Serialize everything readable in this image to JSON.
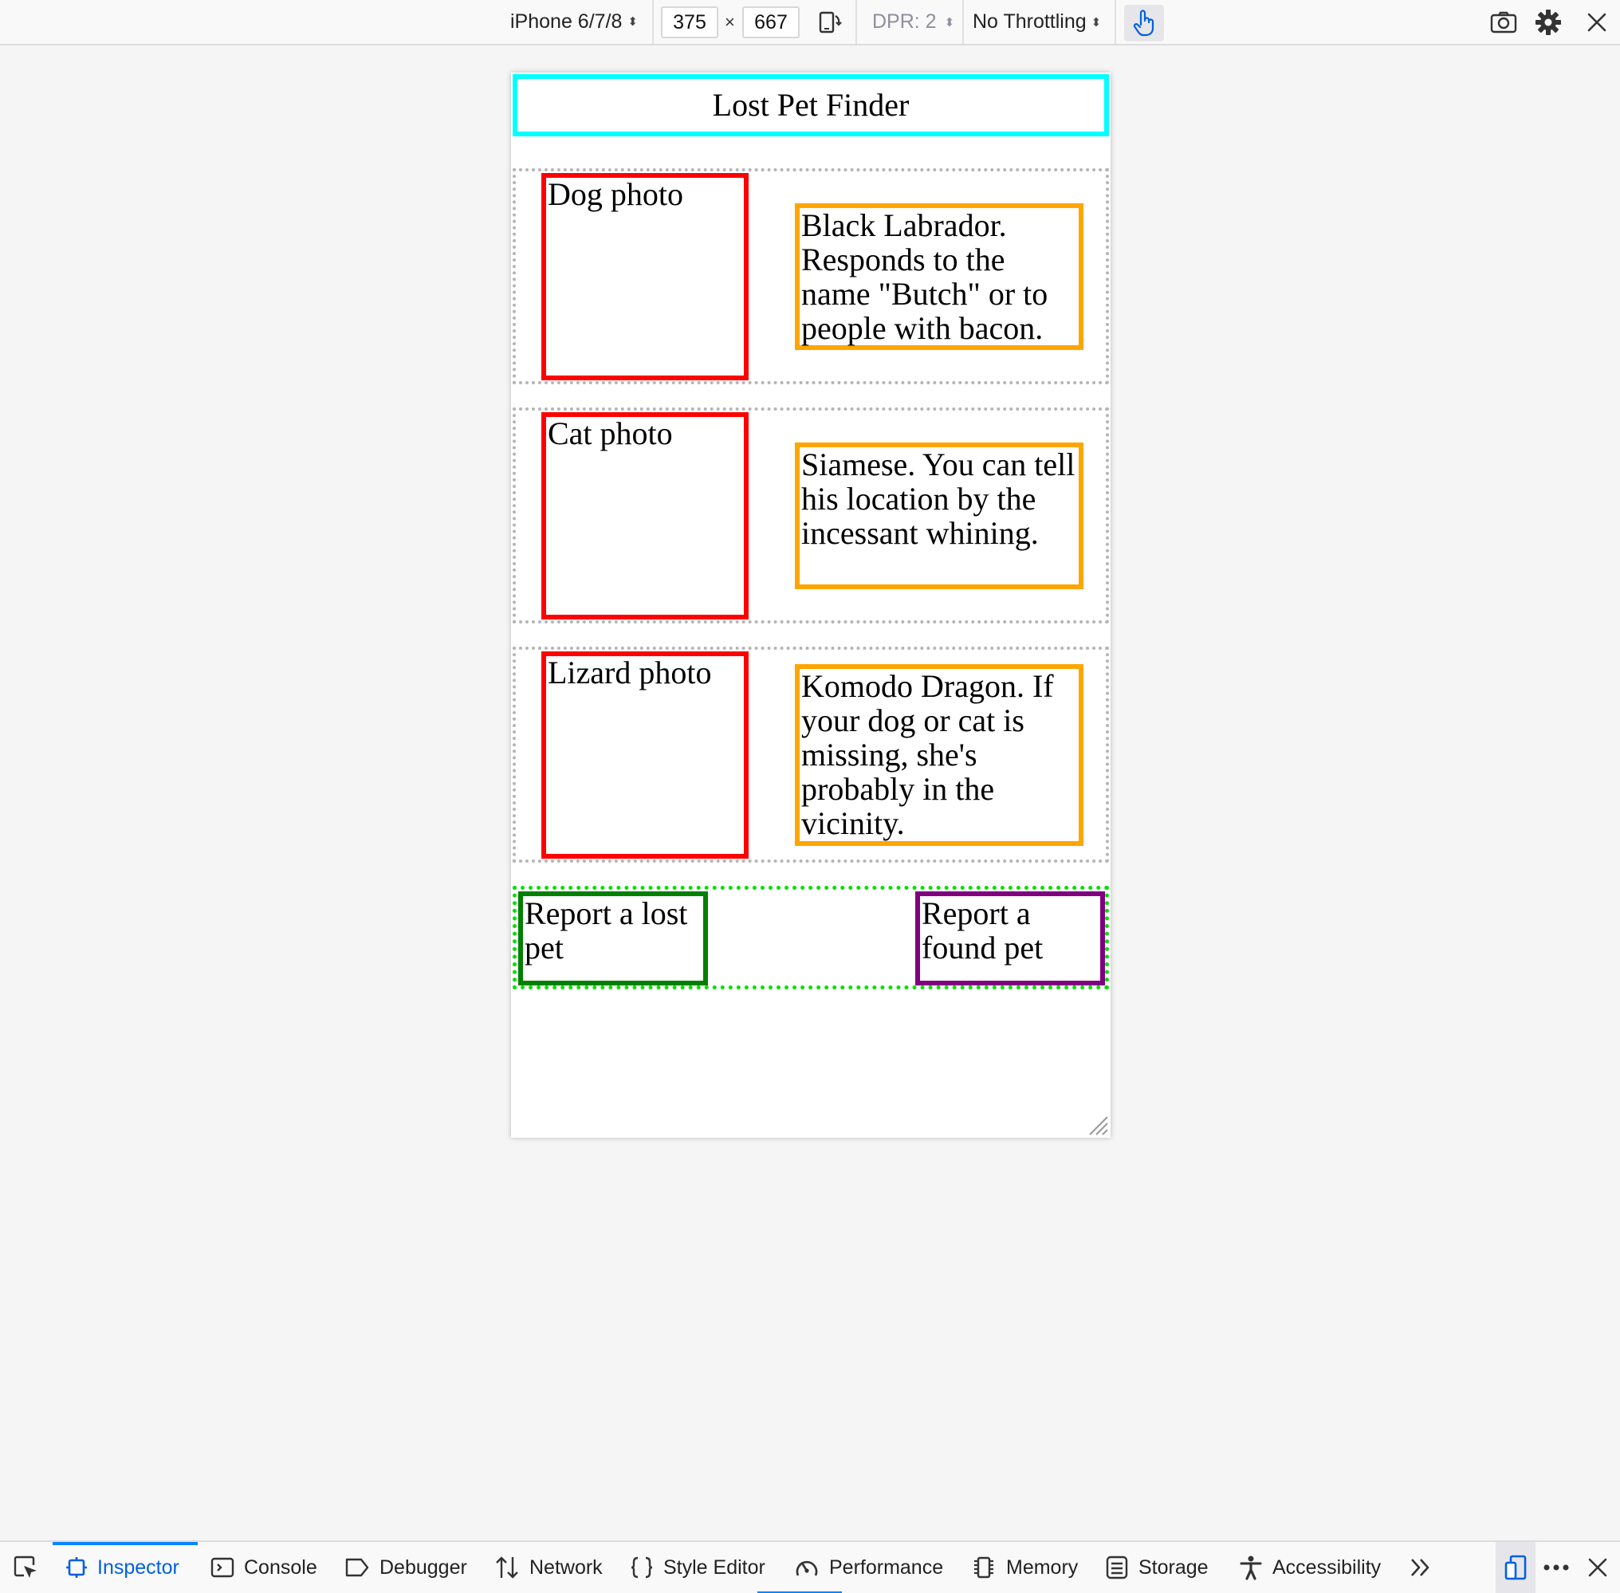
{
  "rdm_toolbar": {
    "device": "iPhone 6/7/8",
    "width": "375",
    "times": "×",
    "height": "667",
    "dpr": "DPR: 2",
    "throttling": "No Throttling",
    "select_arrows": "⬍"
  },
  "page": {
    "title": "Lost Pet Finder",
    "pets": [
      {
        "photo": "Dog photo",
        "description": "Black Labrador. Responds to the name \"Butch\" or to people with bacon."
      },
      {
        "photo": "Cat photo",
        "description": "Siamese. You can tell his location by the incessant whining."
      },
      {
        "photo": "Lizard photo",
        "description": "Komodo Dragon. If your dog or cat is missing, she's probably in the vicinity."
      }
    ],
    "actions": {
      "lost": "Report a lost pet",
      "found": "Report a found pet"
    }
  },
  "devtools": {
    "tabs": [
      "Inspector",
      "Console",
      "Debugger",
      "Network",
      "Style Editor",
      "Performance",
      "Memory",
      "Storage",
      "Accessibility"
    ],
    "selected_tab": "Inspector"
  },
  "colors": {
    "header_border": "#00ffff",
    "photo_border": "#ff0000",
    "description_border": "#ffa500",
    "lost_button_border": "#008000",
    "found_button_border": "#800080",
    "actions_border": "#00e000",
    "selected_tab": "#0060df"
  }
}
